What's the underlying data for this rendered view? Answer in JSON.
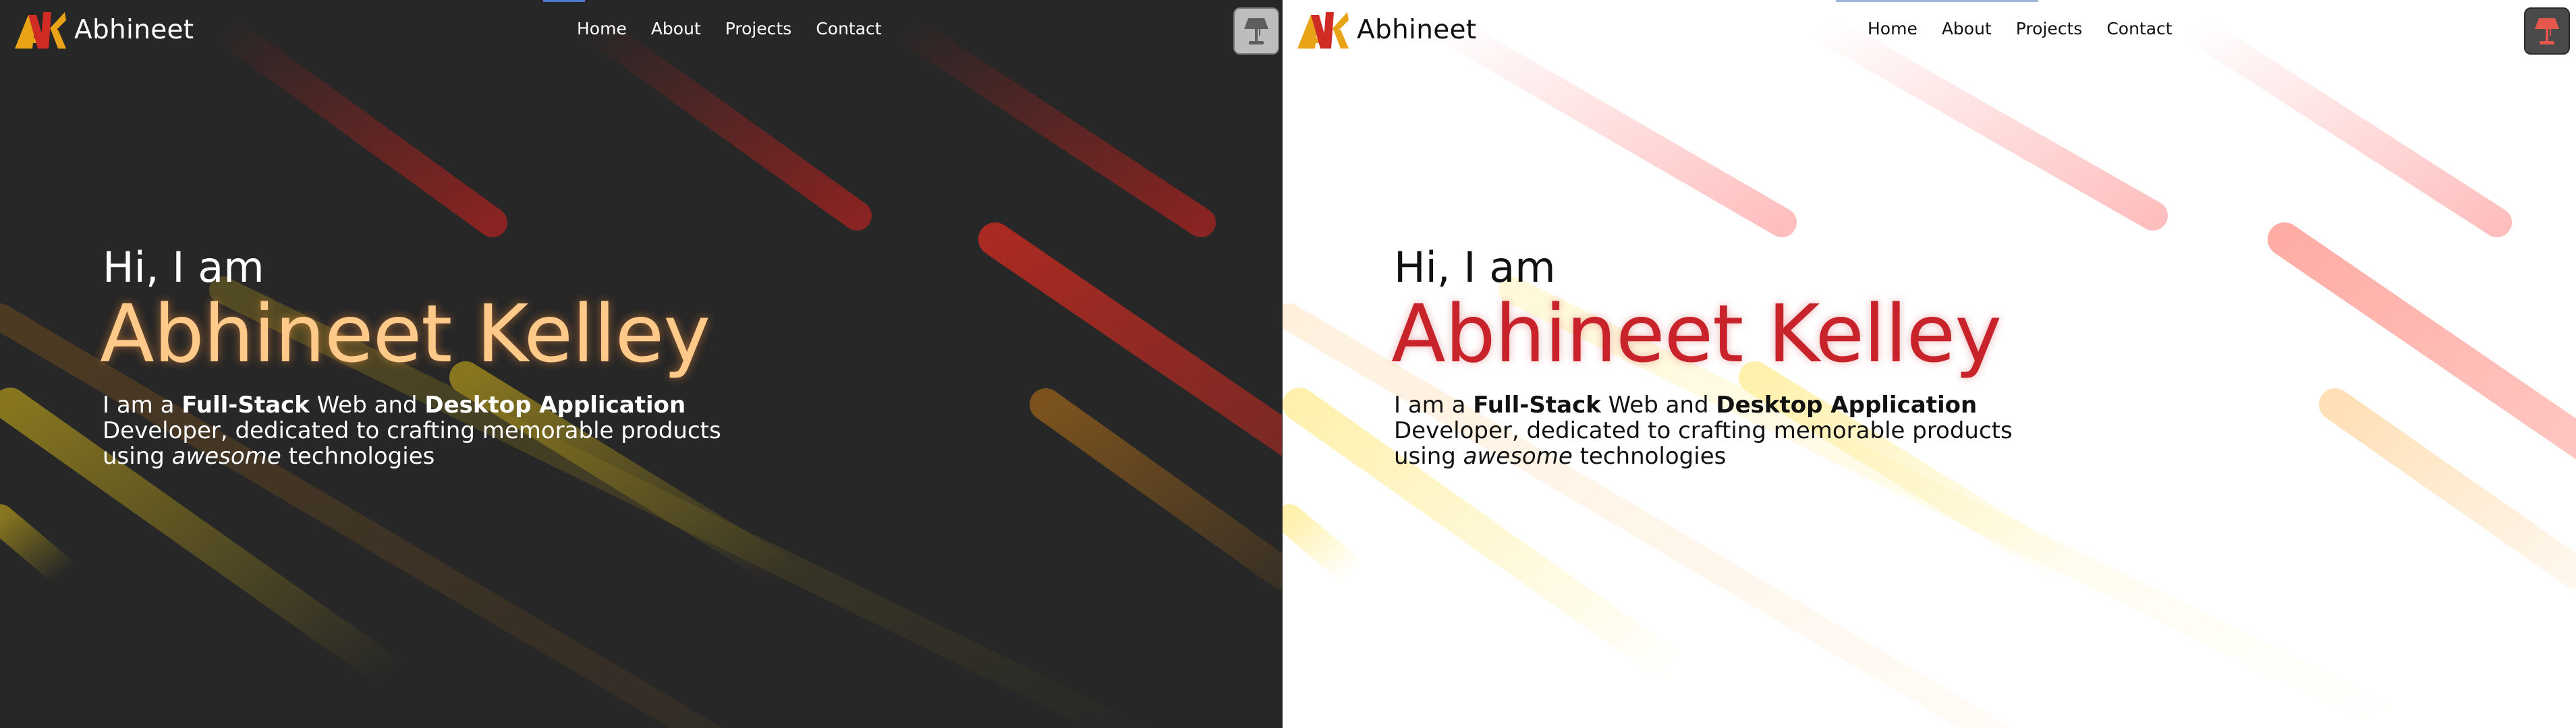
{
  "dark": {
    "brand": {
      "logo_text": "AK",
      "name": "Abhineet"
    },
    "nav": [
      {
        "label": "Home"
      },
      {
        "label": "About"
      },
      {
        "label": "Projects"
      },
      {
        "label": "Contact"
      }
    ],
    "theme_toggle_icon": "lamp-icon",
    "hero": {
      "greeting": "Hi, I am",
      "name": "Abhineet Kelley",
      "bio": {
        "p1": "I am a ",
        "b1": "Full-Stack",
        "p2": " Web and ",
        "b2": "Desktop Application",
        "p3": " Developer, dedicated to crafting memorable products using ",
        "i1": "awesome",
        "p4": " technologies"
      }
    },
    "colors": {
      "background": "#272727",
      "name": "#ffc98a",
      "text": "#ffffff"
    }
  },
  "light": {
    "brand": {
      "logo_text": "AK",
      "name": "Abhineet"
    },
    "nav": [
      {
        "label": "Home"
      },
      {
        "label": "About"
      },
      {
        "label": "Projects"
      },
      {
        "label": "Contact"
      }
    ],
    "theme_toggle_icon": "lamp-icon",
    "hero": {
      "greeting": "Hi, I am",
      "name": "Abhineet Kelley",
      "bio": {
        "p1": "I am a ",
        "b1": "Full-Stack",
        "p2": " Web and ",
        "b2": "Desktop Application",
        "p3": " Developer, dedicated to crafting memorable products using ",
        "i1": "awesome",
        "p4": " technologies"
      }
    },
    "colors": {
      "background": "#ffffff",
      "name": "#c8232a",
      "text": "#111111"
    }
  }
}
